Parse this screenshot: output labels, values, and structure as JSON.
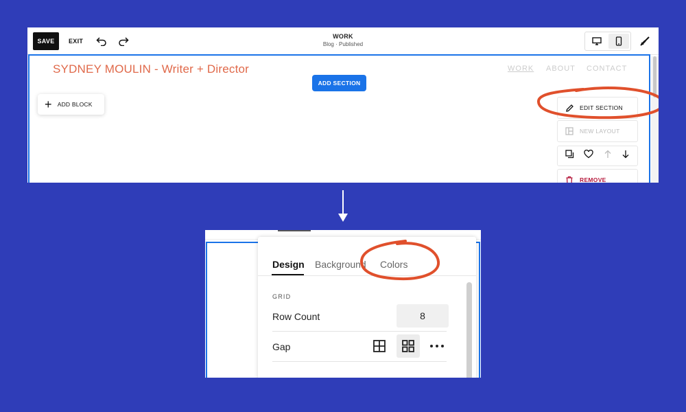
{
  "colors": {
    "background": "#2f3db8",
    "accent_blue": "#1a73e8",
    "title_orange": "#e0694a",
    "annotation_red": "#e0502c",
    "remove_red": "#b5193c"
  },
  "toolbar": {
    "save_label": "SAVE",
    "exit_label": "EXIT",
    "undo_icon": "undo-icon",
    "redo_icon": "redo-icon",
    "page_title": "WORK",
    "page_subtitle": "Blog · Published",
    "desktop_icon": "desktop-icon",
    "mobile_icon": "mobile-icon",
    "design_icon": "paintbrush-icon"
  },
  "site": {
    "title": "SYDNEY MOULIN - Writer + Director",
    "nav": [
      "WORK",
      "ABOUT",
      "CONTACT"
    ],
    "active_nav": "WORK"
  },
  "editor": {
    "add_section_label": "ADD SECTION",
    "add_block_label": "ADD BLOCK",
    "section_menu": {
      "edit_section": "EDIT SECTION",
      "new_layout": "NEW LAYOUT",
      "icons": [
        "duplicate-icon",
        "heart-icon",
        "arrow-up-icon",
        "arrow-down-icon"
      ],
      "remove": "REMOVE"
    }
  },
  "panel": {
    "tabs": [
      "Design",
      "Background",
      "Colors"
    ],
    "active_tab": "Design",
    "grid_heading": "GRID",
    "row_count_label": "Row Count",
    "row_count_value": "8",
    "gap_label": "Gap",
    "gap_options": [
      "grid-gap-icon",
      "grid-spaced-icon",
      "more-dots-icon"
    ],
    "gap_selected": "grid-spaced-icon"
  }
}
